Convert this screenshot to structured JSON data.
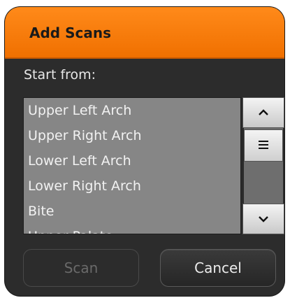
{
  "dialog": {
    "title": "Add Scans",
    "start_label": "Start from:"
  },
  "list": {
    "items": [
      "Upper Left Arch",
      "Upper Right Arch",
      "Lower Left Arch",
      "Lower Right Arch",
      "Bite",
      "Upper Palate"
    ]
  },
  "scrollbar": {
    "up_icon": "chevron-up-icon",
    "thumb_icon": "grip-lines-icon",
    "down_icon": "chevron-down-icon"
  },
  "buttons": {
    "scan_label": "Scan",
    "cancel_label": "Cancel"
  },
  "colors": {
    "title_bar": "#f47a10",
    "dialog_bg": "#2c2c2c",
    "list_bg": "#868686"
  }
}
